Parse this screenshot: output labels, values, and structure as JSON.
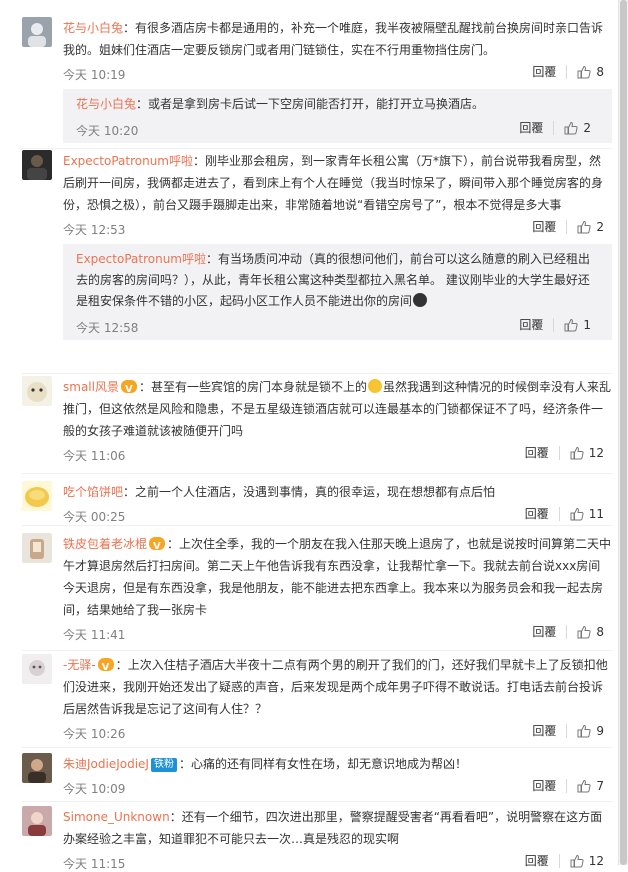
{
  "actions": {
    "reply_label": "回覆"
  },
  "colors": {
    "username": "#eb7350",
    "time": "#808080",
    "sub_bg": "#f2f2f5",
    "link_blue": "#1e90d6"
  },
  "comments": [
    {
      "user": "花与小白兔",
      "text": "有很多酒店房卡都是通用的，补充一个唯庭，我半夜被隔壁乱醒找前台换房间时亲口告诉我的。姐妹们住酒店一定要反锁房门或者用门链锁住，实在不行用重物挡住房门。",
      "time": "今天 10:19",
      "likes": "8",
      "reply": {
        "user": "花与小白兔",
        "text": "或者是拿到房卡后试一下空房间能否打开，能打开立马换酒店。",
        "time": "今天 10:20",
        "likes": "2"
      }
    },
    {
      "user": "ExpectoPatronum呼啦",
      "text": "刚毕业那会租房，到一家青年长租公寓（万*旗下），前台说带我看房型，然后刷开一间房，我俩都走进去了，看到床上有个人在睡觉（我当时惊呆了，瞬间带入那个睡觉房客的身份，恐惧之极），前台又蹑手蹑脚走出来，非常随着地说“看错空房号了”，根本不觉得是多大事",
      "time": "今天 12:53",
      "likes": "2",
      "reply": {
        "user": "ExpectoPatronum呼啦",
        "text": "有当场质问冲动（真的很想问他们，前台可以这么随意的刷入已经租出去的房客的房间吗？），从此，青年长租公寓这种类型都拉入黑名单。 建议刚毕业的大学生最好还是租安保条件不错的小区，起码小区工作人员不能进出你的房间",
        "time": "今天 12:58",
        "likes": "1"
      }
    },
    {
      "user": "small风景",
      "text_a": "甚至有一些宾馆的房门本身就是锁不上的",
      "text_b": "虽然我遇到这种情况的时候倒幸没有人来乱推门，但这依然是风险和隐患，不是五星级连锁酒店就可以连最基本的门锁都保证不了吗，经济条件一般的女孩子难道就该被随便开门吗",
      "time": "今天 11:06",
      "likes": "12"
    },
    {
      "user": "吃个馅饼吧",
      "text": "之前一个人住酒店，没遇到事情，真的很幸运，现在想想都有点后怕",
      "time": "今天 00:25",
      "likes": "11"
    },
    {
      "user": "铁皮包着老冰棍",
      "text": "上次住全季，我的一个朋友在我入住那天晚上退房了，也就是说按时间算第二天中午才算退房然后打扫房间。第二天上午他告诉我有东西没拿，让我帮忙拿一下。我就去前台说xxx房间今天退房，但是有东西没拿，我是他朋友，能不能进去把东西拿上。我本来以为服务员会和我一起去房间，结果她给了我一张房卡",
      "time": "今天 11:41",
      "likes": "8"
    },
    {
      "user": "-无驿-",
      "text": "上次入住桔子酒店大半夜十二点有两个男的刷开了我们的门，还好我们早就卡上了反锁扣他们没进来，我刚开始还发出了疑惑的声音，后来发现是两个成年男子吓得不敢说话。打电话去前台投诉后居然告诉我是忘记了这间有人住？？",
      "time": "今天 10:26",
      "likes": "9"
    },
    {
      "user": "朱迪JodieJodieJ",
      "badge": "铁粉",
      "text": "心痛的还有同样有女性在场，却无意识地成为帮凶！",
      "time": "今天 10:09",
      "likes": "7"
    },
    {
      "user": "Simone_Unknown",
      "text": "还有一个细节，四次进出那里，警察提醒受害者“再看看吧”，说明警察在这方面办案经验之丰富，知道罪犯不可能只去一次…真是残忍的现实啊",
      "time": "今天 11:15",
      "likes": "12"
    }
  ]
}
